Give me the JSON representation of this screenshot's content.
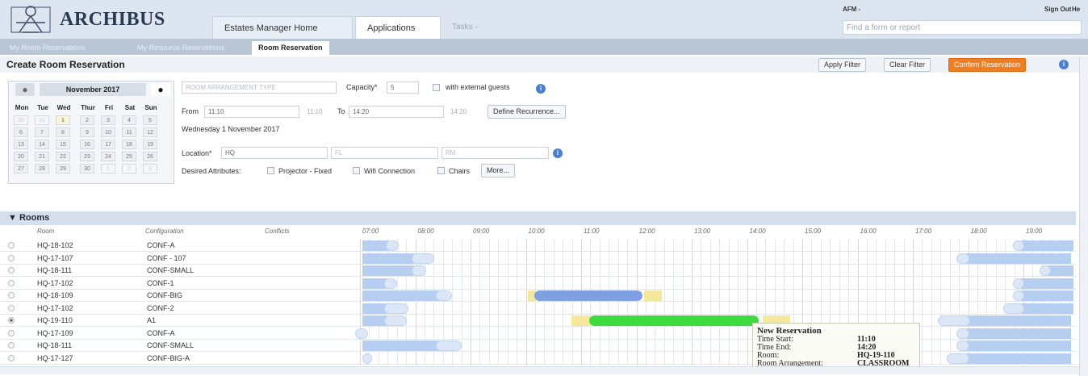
{
  "app": {
    "name": "ARCHIBUS",
    "user": "AFM -",
    "signout": "Sign Out",
    "help": "He",
    "search_placeholder": "Find a form or report"
  },
  "nav": {
    "tabs": [
      "Estates Manager Home",
      "Applications"
    ],
    "tasks": "Tasks -"
  },
  "subtabs": [
    "My Room Reservations",
    "My Resource Reservations",
    "Room Reservation"
  ],
  "toolbar": {
    "title": "Create Room Reservation",
    "apply_filter": "Apply Filter",
    "clear_filter": "Clear Filter",
    "confirm": "Confirm Reservation"
  },
  "calendar": {
    "month": "November 2017",
    "dow": [
      "Mon",
      "Tue",
      "Wed",
      "Thur",
      "Fri",
      "Sat",
      "Sun"
    ],
    "weeks": [
      [
        "30",
        "31",
        "1",
        "2",
        "3",
        "4",
        "5"
      ],
      [
        "6",
        "7",
        "8",
        "9",
        "10",
        "11",
        "12"
      ],
      [
        "13",
        "14",
        "15",
        "16",
        "17",
        "18",
        "19"
      ],
      [
        "20",
        "21",
        "22",
        "23",
        "24",
        "25",
        "26"
      ],
      [
        "27",
        "28",
        "29",
        "30",
        "1",
        "2",
        "3"
      ]
    ]
  },
  "form": {
    "arrangement_placeholder": "ROOM ARRANGEMENT TYPE",
    "capacity_label": "Capacity*",
    "capacity_value": "5",
    "external_label": "with external guests",
    "from_label": "From",
    "from_value": "11:10",
    "from_echo": "11:10",
    "to_label": "To",
    "to_value": "14:20",
    "to_echo": "14:20",
    "recurrence": "Define Recurrence...",
    "date_text": "Wednesday 1 November 2017",
    "location_label": "Location*",
    "location_value": "HQ",
    "fl_placeholder": "FL",
    "rm_placeholder": "RM",
    "attributes_label": "Desired Attributes:",
    "attr1": "Projector - Fixed",
    "attr2": "Wifi Connection",
    "attr3": "Chairs",
    "more": "More..."
  },
  "rooms": {
    "title": "Rooms",
    "columns": [
      "Room",
      "Configuration",
      "Conflicts"
    ],
    "hours": [
      "07:00",
      "08:00",
      "09:00",
      "10:00",
      "11:00",
      "12:00",
      "13:00",
      "14:00",
      "15:00",
      "16:00",
      "17:00",
      "18:00",
      "19:00"
    ],
    "rows": [
      {
        "room": "HQ-18-102",
        "config": "CONF-A"
      },
      {
        "room": "HQ-17-107",
        "config": "CONF - 107"
      },
      {
        "room": "HQ-18-111",
        "config": "CONF-SMALL"
      },
      {
        "room": "HQ-17-102",
        "config": "CONF-1"
      },
      {
        "room": "HQ-18-109",
        "config": "CONF-BIG"
      },
      {
        "room": "HQ-17-102",
        "config": "CONF-2"
      },
      {
        "room": "HQ-19-110",
        "config": "A1"
      },
      {
        "room": "HQ-17-109",
        "config": "CONF-A"
      },
      {
        "room": "HQ-18-111",
        "config": "CONF-SMALL"
      },
      {
        "room": "HQ-17-127",
        "config": "CONF-BIG-A"
      }
    ]
  },
  "tooltip": {
    "title": "New Reservation",
    "start_label": "Time Start:",
    "start": "11:10",
    "end_label": "Time End:",
    "end": "14:20",
    "room_label": "Room:",
    "room": "HQ-19-110",
    "arr_label": "Room Arrangement:",
    "arr": "CLASSROOM"
  },
  "colors": {
    "accent": "#ef7d22",
    "new_reservation": "#3ddc3d",
    "existing_reservation": "#7fa0e0",
    "busy": "#b6cef0"
  }
}
